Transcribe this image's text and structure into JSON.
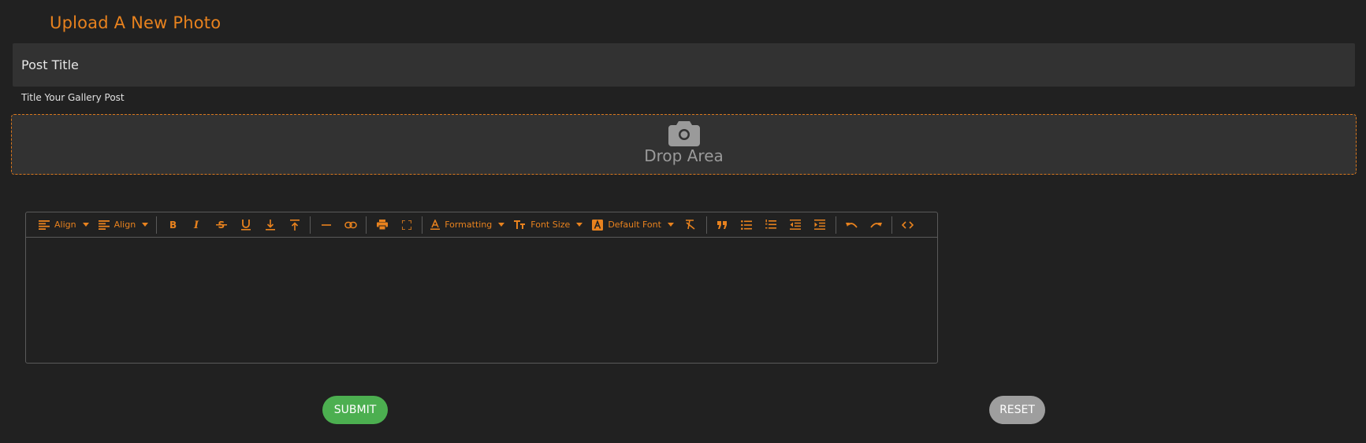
{
  "form": {
    "heading": "Upload A New Photo",
    "title_placeholder": "Post Title",
    "title_value": "",
    "helper_text": "Title Your Gallery Post",
    "drop_area_label": "Drop Area",
    "drop_area_icon": "camera-icon"
  },
  "toolbar": {
    "align_label_1": "Align",
    "align_label_2": "Align",
    "formatting_label": "Formatting",
    "font_size_label": "Font Size",
    "font_label": "Default Font",
    "icons": [
      "align-left-icon",
      "align-left-icon",
      "bold-icon",
      "italic-icon",
      "strikethrough-icon",
      "underline-icon",
      "subscript-icon",
      "superscript-icon",
      "horizontal-rule-icon",
      "link-icon",
      "print-icon",
      "fullscreen-icon",
      "formatting-icon",
      "font-size-icon",
      "font-color-icon",
      "clear-format-icon",
      "blockquote-icon",
      "bullet-list-icon",
      "numbered-list-icon",
      "outdent-icon",
      "indent-icon",
      "undo-icon",
      "redo-icon",
      "code-view-icon"
    ]
  },
  "buttons": {
    "submit_label": "SUBMIT",
    "reset_label": "RESET"
  },
  "colors": {
    "background": "#212121",
    "field": "#323232",
    "accent": "#e8821e",
    "submit": "#4caf50",
    "reset": "#9e9e9e"
  }
}
